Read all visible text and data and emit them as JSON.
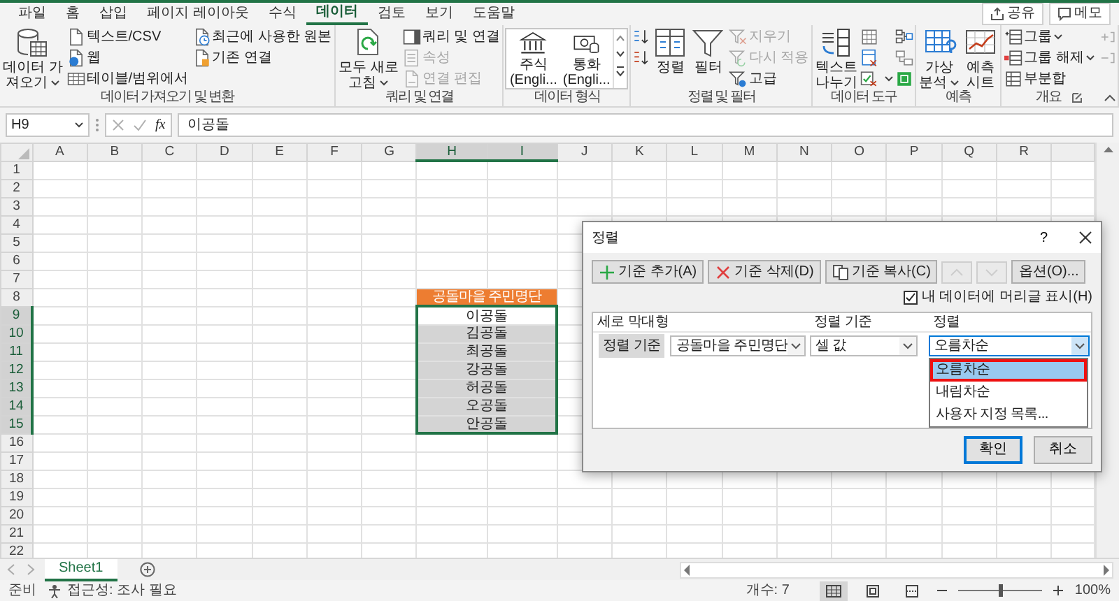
{
  "tabs": [
    {
      "label": "파일",
      "selected": false
    },
    {
      "label": "홈",
      "selected": false
    },
    {
      "label": "삽입",
      "selected": false
    },
    {
      "label": "페이지 레이아웃",
      "selected": false
    },
    {
      "label": "수식",
      "selected": false
    },
    {
      "label": "데이터",
      "selected": true
    },
    {
      "label": "검토",
      "selected": false
    },
    {
      "label": "보기",
      "selected": false
    },
    {
      "label": "도움말",
      "selected": false
    }
  ],
  "header_buttons": [
    "공유",
    "메모"
  ],
  "ribbon": [
    {
      "label": "데이터 가져오기 및 변환",
      "items": [
        {
          "kind": "large",
          "label": "데이터 가\n져오기",
          "dropdown": true,
          "disabled": false
        },
        {
          "kind": "small",
          "label": "텍스트/CSV",
          "disabled": false
        },
        {
          "kind": "small",
          "label": "웹",
          "disabled": false
        },
        {
          "kind": "small",
          "label": "테이블/범위에서",
          "disabled": false
        },
        {
          "kind": "small",
          "label": "최근에 사용한 원본",
          "disabled": false
        },
        {
          "kind": "small",
          "label": "기존 연결",
          "disabled": false
        }
      ]
    },
    {
      "label": "쿼리 및 연결",
      "items": [
        {
          "kind": "large",
          "label": "모두 새로\n고침",
          "dropdown": true,
          "disabled": false
        },
        {
          "kind": "small",
          "label": "쿼리 및 연결",
          "disabled": false
        },
        {
          "kind": "small",
          "label": "속성",
          "disabled": true
        },
        {
          "kind": "small",
          "label": "연결 편집",
          "disabled": true
        }
      ]
    },
    {
      "label": "데이터 형식",
      "items": [
        {
          "kind": "gallery",
          "label": "주식 (Engli..."
        },
        {
          "kind": "gallery",
          "label": "통화 (Engli..."
        }
      ]
    },
    {
      "label": "정렬 및 필터",
      "items": [
        {
          "kind": "icon",
          "disabled": false
        },
        {
          "kind": "icon",
          "disabled": false
        },
        {
          "kind": "large",
          "label": "정렬",
          "disabled": false
        },
        {
          "kind": "large",
          "label": "필터",
          "disabled": false
        },
        {
          "kind": "small",
          "label": "지우기",
          "disabled": true
        },
        {
          "kind": "small",
          "label": "다시 적용",
          "disabled": true
        },
        {
          "kind": "small",
          "label": "고급",
          "disabled": false
        }
      ]
    },
    {
      "label": "데이터 도구",
      "items": [
        {
          "kind": "large",
          "label": "텍스트\n나누기",
          "disabled": false
        },
        {
          "kind": "icon",
          "disabled": false
        },
        {
          "kind": "icon",
          "disabled": false
        },
        {
          "kind": "icon",
          "disabled": false,
          "dropdown": true
        },
        {
          "kind": "icon",
          "disabled": false
        },
        {
          "kind": "icon",
          "disabled": false
        },
        {
          "kind": "icon",
          "disabled": false
        }
      ]
    },
    {
      "label": "예측",
      "items": [
        {
          "kind": "large",
          "label": "가상\n분석",
          "dropdown": true,
          "disabled": false
        },
        {
          "kind": "large",
          "label": "예측\n시트",
          "disabled": false
        }
      ]
    },
    {
      "label": "개요",
      "items": [
        {
          "kind": "small",
          "label": "그룹",
          "dropdown": true,
          "disabled": false
        },
        {
          "kind": "small",
          "label": "그룹 해제",
          "dropdown": true,
          "disabled": false
        },
        {
          "kind": "small",
          "label": "부분합",
          "disabled": false
        },
        {
          "kind": "icon",
          "disabled": true
        },
        {
          "kind": "icon",
          "disabled": true
        }
      ]
    }
  ],
  "formula_bar": {
    "name_box": "H9",
    "function_label": "fx",
    "value": "이공돌"
  },
  "columns": [
    {
      "label": "A",
      "selected": false
    },
    {
      "label": "B",
      "selected": false
    },
    {
      "label": "C",
      "selected": false
    },
    {
      "label": "D",
      "selected": false
    },
    {
      "label": "E",
      "selected": false
    },
    {
      "label": "F",
      "selected": false
    },
    {
      "label": "G",
      "selected": false
    },
    {
      "label": "H",
      "selected": true
    },
    {
      "label": "I",
      "selected": true
    },
    {
      "label": "J",
      "selected": false
    },
    {
      "label": "K",
      "selected": false
    },
    {
      "label": "L",
      "selected": false
    },
    {
      "label": "M",
      "selected": false
    },
    {
      "label": "N",
      "selected": false
    },
    {
      "label": "O",
      "selected": false
    },
    {
      "label": "P",
      "selected": false
    },
    {
      "label": "Q",
      "selected": false
    },
    {
      "label": "R",
      "selected": false
    }
  ],
  "rows": [
    {
      "label": "1",
      "selected": false
    },
    {
      "label": "2",
      "selected": false
    },
    {
      "label": "3",
      "selected": false
    },
    {
      "label": "4",
      "selected": false
    },
    {
      "label": "5",
      "selected": false
    },
    {
      "label": "6",
      "selected": false
    },
    {
      "label": "7",
      "selected": false
    },
    {
      "label": "8",
      "selected": false
    },
    {
      "label": "9",
      "selected": true
    },
    {
      "label": "10",
      "selected": true
    },
    {
      "label": "11",
      "selected": true
    },
    {
      "label": "12",
      "selected": true
    },
    {
      "label": "13",
      "selected": true
    },
    {
      "label": "14",
      "selected": true
    },
    {
      "label": "15",
      "selected": true
    },
    {
      "label": "16",
      "selected": false
    },
    {
      "label": "17",
      "selected": false
    },
    {
      "label": "18",
      "selected": false
    },
    {
      "label": "19",
      "selected": false
    },
    {
      "label": "20",
      "selected": false
    },
    {
      "label": "21",
      "selected": false
    },
    {
      "label": "22",
      "selected": false
    }
  ],
  "sheet": {
    "title": "공돌마을 주민명단",
    "names": [
      {
        "text": "이공돌",
        "active": true
      },
      {
        "text": "김공돌",
        "active": false
      },
      {
        "text": "최공돌",
        "active": false
      },
      {
        "text": "강공돌",
        "active": false
      },
      {
        "text": "허공돌",
        "active": false
      },
      {
        "text": "오공돌",
        "active": false
      },
      {
        "text": "안공돌",
        "active": false
      }
    ]
  },
  "dialog": {
    "title": "정렬",
    "help": "?",
    "toolbar": [
      {
        "label": "기준 추가(A)",
        "disabled": false
      },
      {
        "label": "기준 삭제(D)",
        "disabled": false
      },
      {
        "label": "기준 복사(C)",
        "disabled": false
      },
      {
        "disabled": true
      },
      {
        "disabled": true
      },
      {
        "label": "옵션(O)...",
        "disabled": false
      }
    ],
    "header_checkbox": {
      "label": "내 데이터에 머리글 표시(H)",
      "checked": true
    },
    "columns": [
      "세로 막대형",
      "정렬 기준",
      "정렬"
    ],
    "levels": [
      {
        "label": "정렬 기준",
        "selected": true,
        "column": "공돌마을 주민명단",
        "sort_on": "셀 값",
        "order": "오름차순"
      }
    ],
    "dropdown": {
      "open": true,
      "options": [
        {
          "label": "오름차순",
          "selected": true,
          "outlined": true
        },
        {
          "label": "내림차순",
          "selected": false,
          "outlined": false
        },
        {
          "label": "사용자 지정 목록...",
          "selected": false,
          "outlined": false
        }
      ]
    },
    "buttons": [
      {
        "label": "확인",
        "default": true
      },
      {
        "label": "취소",
        "default": false
      }
    ]
  },
  "sheet_tabs": [
    {
      "label": "Sheet1",
      "selected": true
    }
  ],
  "status_bar": {
    "ready": "준비",
    "accessibility": "접근성: 조사 필요",
    "count": "개수: 7",
    "views": [
      {
        "selected": true
      },
      {
        "selected": false
      },
      {
        "selected": false
      }
    ],
    "zoom": {
      "level": 0.5,
      "reading": "100%"
    }
  }
}
